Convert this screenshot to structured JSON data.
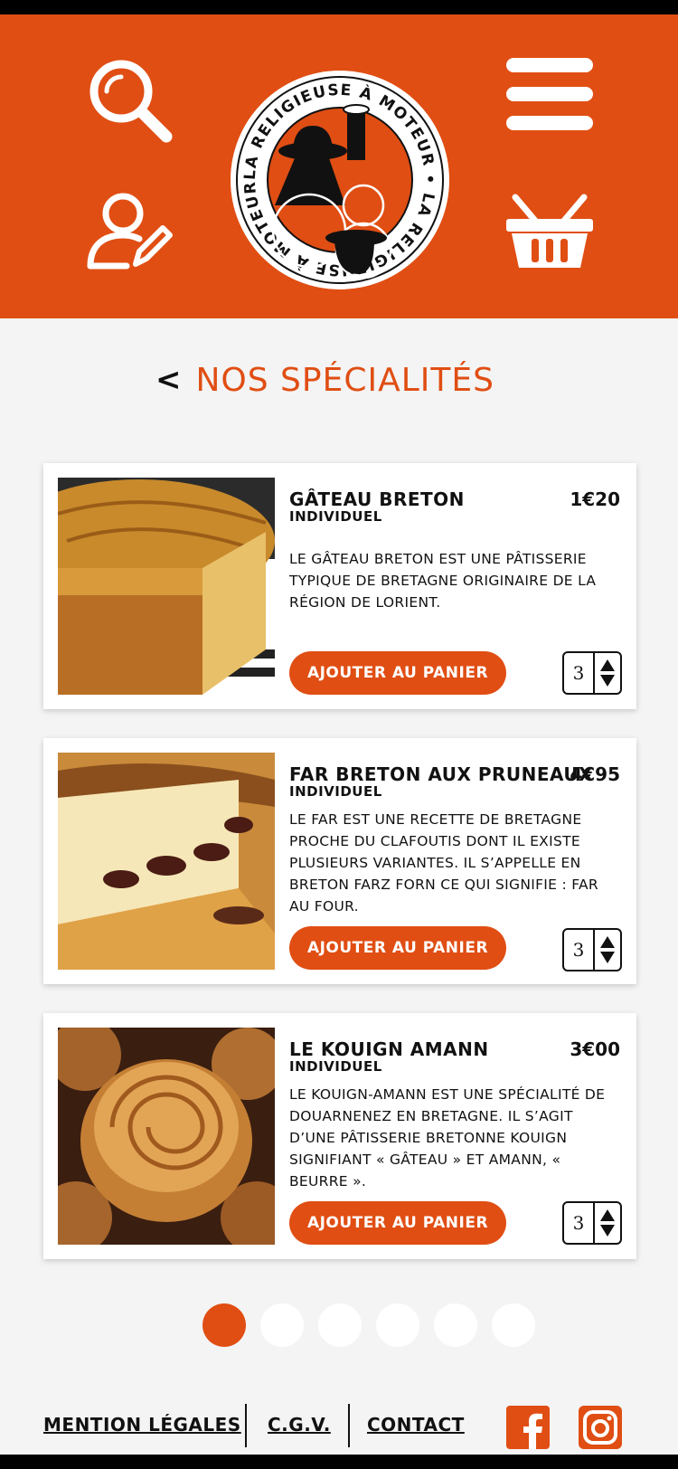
{
  "brand": {
    "accent": "#e04e13",
    "logo_text": "LA RELIGIEUSE À MOTEUR"
  },
  "header": {
    "icons": [
      "search-icon",
      "menu-icon",
      "user-edit-icon",
      "basket-icon"
    ]
  },
  "page": {
    "back": "<",
    "title": "NOS SPÉCIALITÉS"
  },
  "products": [
    {
      "name": "GÂTEAU BRETON",
      "price": "1€20",
      "subtitle": "INDIVIDUEL",
      "description": "LE GÂTEAU BRETON EST UNE PÂTISSERIE TYPIQUE DE BRETAGNE ORIGINAIRE DE LA RÉGION DE LORIENT.",
      "button": "AJOUTER AU PANIER",
      "quantity": "3"
    },
    {
      "name": "FAR BRETON AUX PRUNEAUX",
      "price": "4€95",
      "subtitle": "INDIVIDUEL",
      "description": "LE FAR EST UNE RECETTE DE BRETAGNE PROCHE DU CLAFOUTIS DONT IL EXISTE PLUSIEURS VARIANTES. IL S’APPELLE EN BRETON FARZ FORN CE QUI SIGNIFIE : FAR AU FOUR.",
      "button": "AJOUTER AU PANIER",
      "quantity": "3"
    },
    {
      "name": "LE KOUIGN AMANN",
      "price": "3€00",
      "subtitle": "INDIVIDUEL",
      "description": "LE KOUIGN-AMANN EST UNE SPÉCIALITÉ DE DOUARNENEZ EN BRETAGNE. IL S’AGIT D’UNE PÂTISSERIE BRETONNE KOUIGN SIGNIFIANT « GÂTEAU » ET AMANN, « BEURRE ».",
      "button": "AJOUTER AU PANIER",
      "quantity": "3"
    }
  ],
  "pagination": {
    "total": 6,
    "active": 1
  },
  "footer": {
    "links": [
      "MENTION LÉGALES",
      "C.G.V.",
      "CONTACT"
    ],
    "social": [
      "facebook-icon",
      "instagram-icon"
    ]
  }
}
